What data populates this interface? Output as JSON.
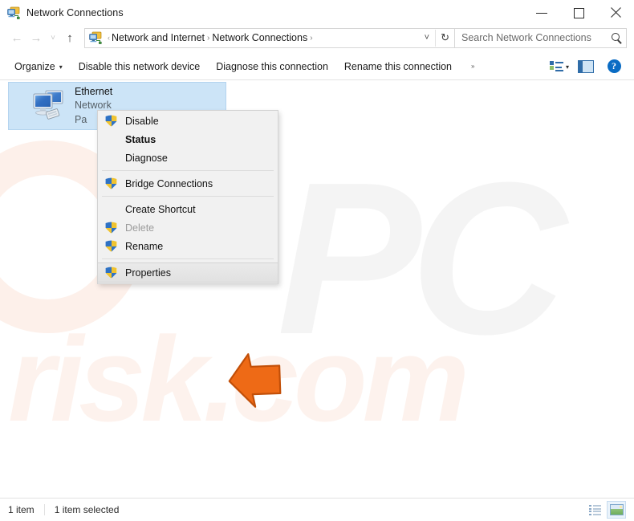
{
  "window": {
    "title": "Network Connections",
    "title_icon": "network-connections-icon",
    "minimize_label": "Minimize",
    "maximize_label": "Maximize",
    "close_label": "Close"
  },
  "nav": {
    "back": "←",
    "forward": "→",
    "recent": "˅",
    "up": "↑"
  },
  "address": {
    "icon": "network-folder-icon",
    "crumbs": [
      {
        "label": "Network and Internet"
      },
      {
        "label": "Network Connections"
      }
    ],
    "separator": "›",
    "leading_separator": "‹",
    "dropdown": "˅",
    "refresh": "↻"
  },
  "search": {
    "placeholder": "Search Network Connections",
    "icon": "search-icon"
  },
  "toolbar": {
    "organize": "Organize",
    "organize_caret": "▾",
    "disable_device": "Disable this network device",
    "diagnose_connection": "Diagnose this connection",
    "rename_connection": "Rename this connection",
    "overflow": "»",
    "change_view_icon": "change-view-icon",
    "change_view_caret": "▾",
    "preview_pane_icon": "preview-pane-icon",
    "help_icon": "help-icon",
    "help_glyph": "?"
  },
  "list": {
    "items": [
      {
        "icon": "ethernet-adapter-icon",
        "name": "Ethernet",
        "network": "Network",
        "adapter": "Pa"
      }
    ]
  },
  "context_menu": {
    "items": [
      {
        "label": "Disable",
        "icon": "uac-shield-icon",
        "bold": false,
        "disabled": false,
        "highlight": false
      },
      {
        "label": "Status",
        "icon": "",
        "bold": true,
        "disabled": false,
        "highlight": false
      },
      {
        "label": "Diagnose",
        "icon": "",
        "bold": false,
        "disabled": false,
        "highlight": false
      },
      {
        "separator": true
      },
      {
        "label": "Bridge Connections",
        "icon": "uac-shield-icon",
        "bold": false,
        "disabled": false,
        "highlight": false
      },
      {
        "separator": true
      },
      {
        "label": "Create Shortcut",
        "icon": "",
        "bold": false,
        "disabled": false,
        "highlight": false
      },
      {
        "label": "Delete",
        "icon": "uac-shield-icon",
        "bold": false,
        "disabled": true,
        "highlight": false
      },
      {
        "label": "Rename",
        "icon": "uac-shield-icon",
        "bold": false,
        "disabled": false,
        "highlight": false
      },
      {
        "separator": true
      },
      {
        "label": "Properties",
        "icon": "uac-shield-icon",
        "bold": false,
        "disabled": false,
        "highlight": true
      }
    ]
  },
  "cursor": {
    "name": "orange-arrow-pointer",
    "color": "#ee6a16"
  },
  "watermarks": {
    "brand": "PC",
    "domain": "risk.com",
    "brand_color": "#f4f4f4",
    "domain_color": "#fdf2ed"
  },
  "statusbar": {
    "item_count": "1 item",
    "selection": "1 item selected",
    "details_view_icon": "details-view-icon",
    "icons_view_icon": "large-icons-view-icon"
  },
  "colors": {
    "selection_bg": "#cce4f7",
    "accent": "#0a6cc4",
    "menu_bg": "#f1f1f1"
  }
}
